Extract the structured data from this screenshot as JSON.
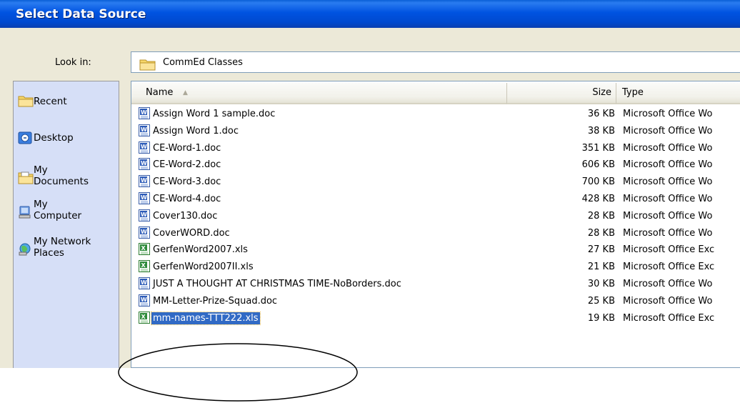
{
  "dialog": {
    "title": "Select Data Source"
  },
  "lookin": {
    "label": "Look in:",
    "value": "CommEd Classes"
  },
  "places": [
    {
      "label": "Recent"
    },
    {
      "label": "Desktop"
    },
    {
      "line1": "My",
      "line2": "Documents"
    },
    {
      "line1": "My",
      "line2": "Computer"
    },
    {
      "line1": "My Network",
      "line2": "Places"
    }
  ],
  "columns": {
    "name": "Name",
    "size": "Size",
    "type": "Type"
  },
  "files": [
    {
      "name": "Assign Word 1 sample.doc",
      "size": "36 KB",
      "type": "Microsoft Office Wo",
      "kind": "word"
    },
    {
      "name": "Assign Word 1.doc",
      "size": "38 KB",
      "type": "Microsoft Office Wo",
      "kind": "word"
    },
    {
      "name": "CE-Word-1.doc",
      "size": "351 KB",
      "type": "Microsoft Office Wo",
      "kind": "word"
    },
    {
      "name": "CE-Word-2.doc",
      "size": "606 KB",
      "type": "Microsoft Office Wo",
      "kind": "word"
    },
    {
      "name": "CE-Word-3.doc",
      "size": "700 KB",
      "type": "Microsoft Office Wo",
      "kind": "word"
    },
    {
      "name": "CE-Word-4.doc",
      "size": "428 KB",
      "type": "Microsoft Office Wo",
      "kind": "word"
    },
    {
      "name": "Cover130.doc",
      "size": "28 KB",
      "type": "Microsoft Office Wo",
      "kind": "word"
    },
    {
      "name": "CoverWORD.doc",
      "size": "28 KB",
      "type": "Microsoft Office Wo",
      "kind": "word"
    },
    {
      "name": "GerfenWord2007.xls",
      "size": "27 KB",
      "type": "Microsoft Office Exc",
      "kind": "excel"
    },
    {
      "name": "GerfenWord2007II.xls",
      "size": "21 KB",
      "type": "Microsoft Office Exc",
      "kind": "excel"
    },
    {
      "name": "JUST A THOUGHT AT CHRISTMAS TIME-NoBorders.doc",
      "size": "30 KB",
      "type": "Microsoft Office Wo",
      "kind": "word"
    },
    {
      "name": "MM-Letter-Prize-Squad.doc",
      "size": "25 KB",
      "type": "Microsoft Office Wo",
      "kind": "word"
    },
    {
      "name": "mm-names-TTT222.xls",
      "size": "19 KB",
      "type": "Microsoft Office Exc",
      "kind": "excel",
      "selected": true
    }
  ],
  "colors": {
    "title_bar": "#0053e1",
    "selection": "#316ac5",
    "places_bg": "#d6dff7",
    "dialog_bg": "#ece9d8"
  }
}
